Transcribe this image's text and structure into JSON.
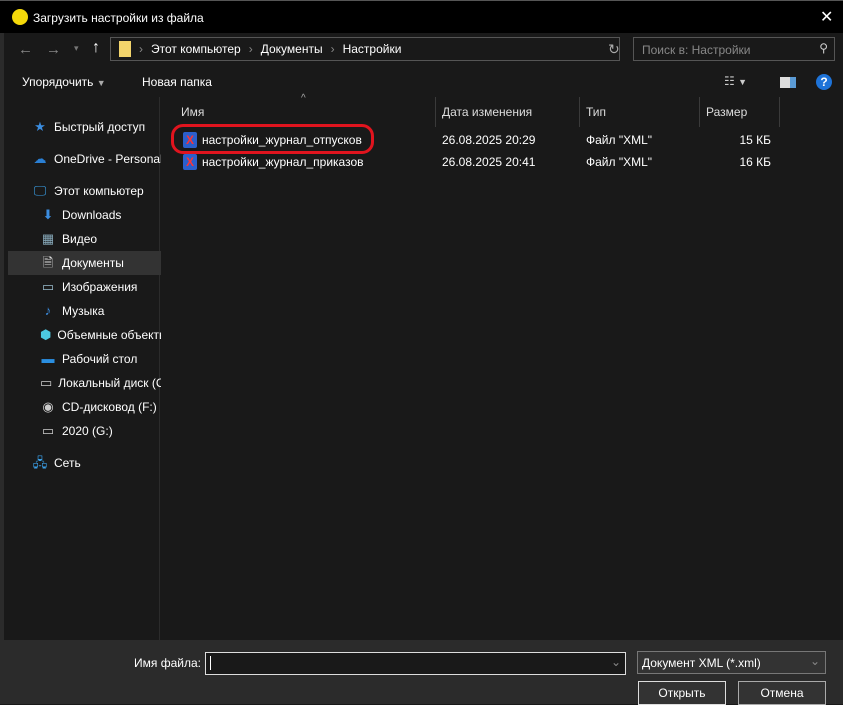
{
  "window": {
    "title": "Загрузить настройки из файла",
    "close": "✕"
  },
  "nav": {
    "breadcrumb": [
      "Этот компьютер",
      "Документы",
      "Настройки"
    ],
    "search_placeholder": "Поиск в: Настройки"
  },
  "toolbar": {
    "organize": "Упорядочить",
    "new_folder": "Новая папка"
  },
  "sidebar": {
    "items": [
      {
        "label": "Быстрый доступ",
        "icon": "star-icon"
      },
      {
        "label": "OneDrive - Personal",
        "icon": "cloud-icon"
      },
      {
        "label": "Этот компьютер",
        "icon": "computer-icon"
      },
      {
        "label": "Downloads",
        "icon": "download-icon"
      },
      {
        "label": "Видео",
        "icon": "video-icon"
      },
      {
        "label": "Документы",
        "icon": "document-icon"
      },
      {
        "label": "Изображения",
        "icon": "image-icon"
      },
      {
        "label": "Музыка",
        "icon": "music-icon"
      },
      {
        "label": "Объемные объекты",
        "icon": "cube-icon"
      },
      {
        "label": "Рабочий стол",
        "icon": "desktop-icon"
      },
      {
        "label": "Локальный диск (C:)",
        "icon": "drive-icon"
      },
      {
        "label": "CD-дисковод (F:)",
        "icon": "cd-icon"
      },
      {
        "label": "2020 (G:)",
        "icon": "drive-icon"
      },
      {
        "label": "Сеть",
        "icon": "network-icon"
      }
    ]
  },
  "columns": [
    "Имя",
    "Дата изменения",
    "Тип",
    "Размер"
  ],
  "files": [
    {
      "name": "настройки_журнал_отпусков",
      "date": "26.08.2025 20:29",
      "type": "Файл \"XML\"",
      "size": "15 КБ"
    },
    {
      "name": "настройки_журнал_приказов",
      "date": "26.08.2025 20:41",
      "type": "Файл \"XML\"",
      "size": "16 КБ"
    }
  ],
  "bottom": {
    "filename_label": "Имя файла:",
    "filename_value": "",
    "filter": "Документ XML (*.xml)",
    "open": "Открыть",
    "cancel": "Отмена"
  },
  "colors": {
    "highlight": "#e0141e",
    "selected": "#333333"
  }
}
